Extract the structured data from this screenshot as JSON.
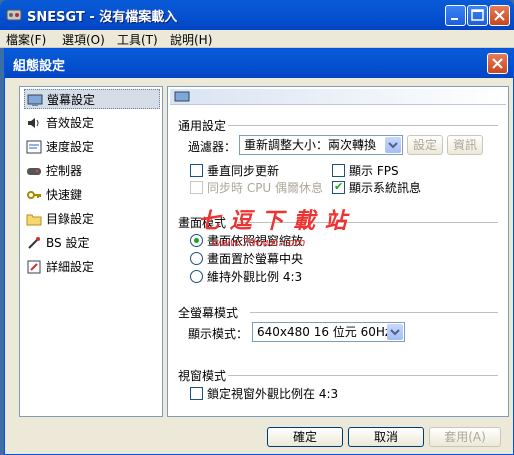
{
  "app": {
    "title": "SNESGT - 沒有檔案載入"
  },
  "menubar": [
    {
      "label": "檔案(F)"
    },
    {
      "label": "選項(O)"
    },
    {
      "label": "工具(T)"
    },
    {
      "label": "說明(H)"
    }
  ],
  "dialog": {
    "title": "組態設定",
    "nav": [
      {
        "label": "螢幕設定",
        "icon": "display-settings-icon"
      },
      {
        "label": "音效設定",
        "icon": "speaker-icon"
      },
      {
        "label": "速度設定",
        "icon": "speed-icon"
      },
      {
        "label": "控制器",
        "icon": "gamepad-icon"
      },
      {
        "label": "快速鍵",
        "icon": "key-icon"
      },
      {
        "label": "目錄設定",
        "icon": "folder-icon"
      },
      {
        "label": "BS 設定",
        "icon": "bs-icon"
      },
      {
        "label": "詳細設定",
        "icon": "detail-settings-icon"
      }
    ],
    "general": {
      "section": "通用設定",
      "filter_label": "過濾器：",
      "filter_value": "重新調整大小：兩次轉換",
      "settings_button": "設定",
      "info_button": "資訊",
      "vsync": "垂直同步更新",
      "show_fps": "顯示 FPS",
      "cpu_idle": "同步時 CPU 偶爾休息",
      "show_sysinfo": "顯示系統訊息"
    },
    "screen_mode": {
      "section": "畫面模式",
      "opt1": "畫面依照視窗縮放",
      "opt2": "畫面置於螢幕中央",
      "opt3": "維持外觀比例 4:3"
    },
    "fullscreen": {
      "section": "全螢幕模式",
      "display_label": "顯示模式：",
      "display_value": "640x480 16 位元 60Hz"
    },
    "window_mode": {
      "section": "視窗模式",
      "lock_ratio": "鎖定視窗外觀比例在 4:3"
    },
    "buttons": {
      "ok": "確定",
      "cancel": "取消",
      "apply": "套用(A)"
    },
    "watermark": {
      "line1": "七 逗 下 載 站",
      "line2": "www.7down.com"
    }
  }
}
